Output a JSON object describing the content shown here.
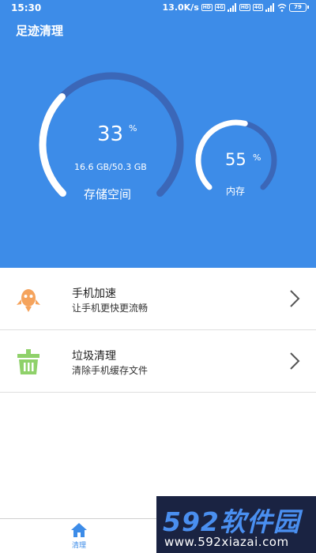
{
  "status_bar": {
    "time": "15:30",
    "speed": "13.0K/s",
    "hd1": "HD",
    "net1": "4G",
    "hd2": "HD",
    "net2": "4G",
    "battery": "79"
  },
  "app": {
    "title": "足迹清理"
  },
  "storage_gauge": {
    "value": "33",
    "unit": "%",
    "detail": "16.6 GB/50.3 GB",
    "label": "存储空间",
    "fraction": 0.33
  },
  "memory_gauge": {
    "value": "55",
    "unit": "%",
    "label": "内存",
    "fraction": 0.55
  },
  "list": {
    "items": [
      {
        "title": "手机加速",
        "subtitle": "让手机更快更流畅",
        "icon": "rocket-icon"
      },
      {
        "title": "垃圾清理",
        "subtitle": "清除手机缓存文件",
        "icon": "trash-bin-icon"
      }
    ]
  },
  "bottom_nav": {
    "items": [
      {
        "label": "清理",
        "icon": "home-icon",
        "active": true
      }
    ]
  },
  "watermark": {
    "brand": "592软件园",
    "url": "www.592xiazai.com"
  },
  "colors": {
    "primary": "#3d8ce8",
    "gauge_track": "#3b67b8",
    "gauge_fill": "#ffffff",
    "rocket": "#f5a35c",
    "trash": "#8fd16a"
  }
}
